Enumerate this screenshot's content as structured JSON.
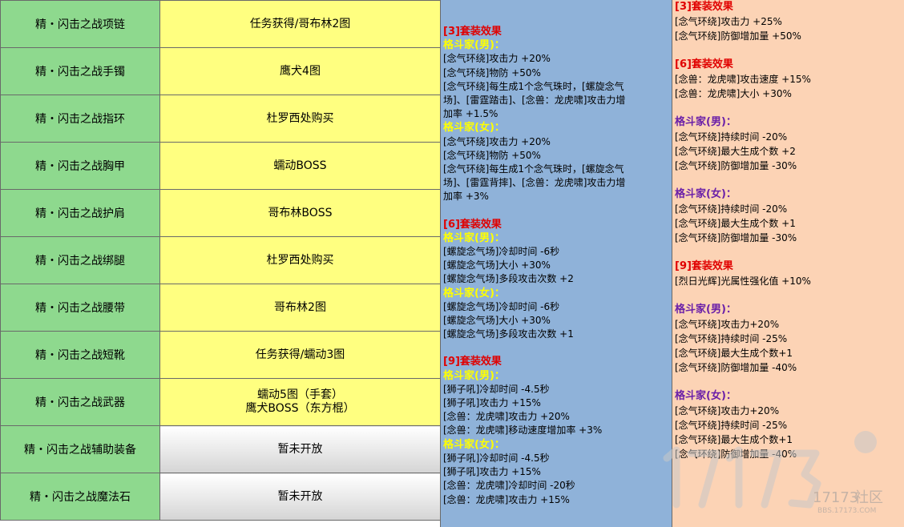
{
  "items": [
    {
      "name": "精・闪击之战项链",
      "source": [
        "任务获得/哥布林2图"
      ],
      "pending": false
    },
    {
      "name": "精・闪击之战手镯",
      "source": [
        "鹰犬4图"
      ],
      "pending": false
    },
    {
      "name": "精・闪击之战指环",
      "source": [
        "杜罗西处购买"
      ],
      "pending": false
    },
    {
      "name": "精・闪击之战胸甲",
      "source": [
        "蠕动BOSS"
      ],
      "pending": false
    },
    {
      "name": "精・闪击之战护肩",
      "source": [
        "哥布林BOSS"
      ],
      "pending": false
    },
    {
      "name": "精・闪击之战绑腿",
      "source": [
        "杜罗西处购买"
      ],
      "pending": false
    },
    {
      "name": "精・闪击之战腰带",
      "source": [
        "哥布林2图"
      ],
      "pending": false
    },
    {
      "name": "精・闪击之战短靴",
      "source": [
        "任务获得/蠕动3图"
      ],
      "pending": false
    },
    {
      "name": "精・闪击之战武器",
      "source": [
        "蠕动5图（手套）",
        "鹰犬BOSS（东方棍）"
      ],
      "pending": false
    },
    {
      "name": "精・闪击之战辅助装备",
      "source": [
        "暂未开放"
      ],
      "pending": true
    },
    {
      "name": "精・闪击之战魔法石",
      "source": [
        "暂未开放"
      ],
      "pending": true
    }
  ],
  "col3": [
    {
      "t": "red",
      "text": "[3]套装效果"
    },
    {
      "t": "yel",
      "text": "格斗家(男)："
    },
    {
      "t": "n",
      "text": "[念气环绕]攻击力 +20%"
    },
    {
      "t": "n",
      "text": "[念气环绕]物防 +50%"
    },
    {
      "t": "n",
      "text": "[念气环绕]每生成1个念气珠时，[螺旋念气"
    },
    {
      "t": "n",
      "text": "场]、[雷霆踏击]、[念兽：龙虎啸]攻击力增"
    },
    {
      "t": "n",
      "text": "加率 +1.5%"
    },
    {
      "t": "yel",
      "text": "格斗家(女)："
    },
    {
      "t": "n",
      "text": "[念气环绕]攻击力 +20%"
    },
    {
      "t": "n",
      "text": "[念气环绕]物防 +50%"
    },
    {
      "t": "n",
      "text": "[念气环绕]每生成1个念气珠时，[螺旋念气"
    },
    {
      "t": "n",
      "text": "场]、[雷霆背摔]、[念兽：龙虎啸]攻击力增"
    },
    {
      "t": "n",
      "text": "加率 +3%"
    },
    {
      "t": "gap",
      "text": ""
    },
    {
      "t": "red",
      "text": "[6]套装效果"
    },
    {
      "t": "yel",
      "text": "格斗家(男)："
    },
    {
      "t": "n",
      "text": "[螺旋念气场]冷却时间 -6秒"
    },
    {
      "t": "n",
      "text": "[螺旋念气场]大小 +30%"
    },
    {
      "t": "n",
      "text": "[螺旋念气场]多段攻击次数 +2"
    },
    {
      "t": "yel",
      "text": "格斗家(女)："
    },
    {
      "t": "n",
      "text": "[螺旋念气场]冷却时间 -6秒"
    },
    {
      "t": "n",
      "text": "[螺旋念气场]大小 +30%"
    },
    {
      "t": "n",
      "text": "[螺旋念气场]多段攻击次数 +1"
    },
    {
      "t": "gap",
      "text": ""
    },
    {
      "t": "red",
      "text": "[9]套装效果"
    },
    {
      "t": "yel",
      "text": "格斗家(男)："
    },
    {
      "t": "n",
      "text": "[狮子吼]冷却时间 -4.5秒"
    },
    {
      "t": "n",
      "text": "[狮子吼]攻击力 +15%"
    },
    {
      "t": "n",
      "text": "[念兽：龙虎啸]攻击力 +20%"
    },
    {
      "t": "n",
      "text": "[念兽：龙虎啸]移动速度增加率 +3%"
    },
    {
      "t": "yel",
      "text": "格斗家(女)："
    },
    {
      "t": "n",
      "text": "[狮子吼]冷却时间 -4.5秒"
    },
    {
      "t": "n",
      "text": "[狮子吼]攻击力 +15%"
    },
    {
      "t": "n",
      "text": "[念兽：龙虎啸]冷却时间 -20秒"
    },
    {
      "t": "n",
      "text": "[念兽：龙虎啸]攻击力 +15%"
    }
  ],
  "col4": [
    {
      "t": "red",
      "text": "[3]套装效果"
    },
    {
      "t": "n",
      "text": "[念气环绕]攻击力 +25%"
    },
    {
      "t": "n",
      "text": "[念气环绕]防御增加量 +50%"
    },
    {
      "t": "gap",
      "text": ""
    },
    {
      "t": "red",
      "text": "[6]套装效果"
    },
    {
      "t": "n",
      "text": "[念兽：龙虎啸]攻击速度 +15%"
    },
    {
      "t": "n",
      "text": "[念兽：龙虎啸]大小 +30%"
    },
    {
      "t": "gap",
      "text": ""
    },
    {
      "t": "pur",
      "text": "格斗家(男)："
    },
    {
      "t": "n",
      "text": "[念气环绕]持续时间 -20%"
    },
    {
      "t": "n",
      "text": "[念气环绕]最大生成个数 +2"
    },
    {
      "t": "n",
      "text": "[念气环绕]防御增加量 -30%"
    },
    {
      "t": "gap",
      "text": ""
    },
    {
      "t": "pur",
      "text": "格斗家(女)："
    },
    {
      "t": "n",
      "text": "[念气环绕]持续时间 -20%"
    },
    {
      "t": "n",
      "text": "[念气环绕]最大生成个数 +1"
    },
    {
      "t": "n",
      "text": "[念气环绕]防御增加量 -30%"
    },
    {
      "t": "gap",
      "text": ""
    },
    {
      "t": "red",
      "text": "[9]套装效果"
    },
    {
      "t": "n",
      "text": "[烈日光辉]光属性强化值 +10%"
    },
    {
      "t": "gap",
      "text": ""
    },
    {
      "t": "pur",
      "text": "格斗家(男)："
    },
    {
      "t": "n",
      "text": "[念气环绕]攻击力+20%"
    },
    {
      "t": "n",
      "text": "[念气环绕]持续时间 -25%"
    },
    {
      "t": "n",
      "text": "[念气环绕]最大生成个数+1"
    },
    {
      "t": "n",
      "text": "[念气环绕]防御增加量 -40%"
    },
    {
      "t": "gap",
      "text": ""
    },
    {
      "t": "pur",
      "text": "格斗家(女)："
    },
    {
      "t": "n",
      "text": "[念气环绕]攻击力+20%"
    },
    {
      "t": "n",
      "text": "[念气环绕]持续时间 -25%"
    },
    {
      "t": "n",
      "text": "[念气环绕]最大生成个数+1"
    },
    {
      "t": "n",
      "text": "[念气环绕]防御增加量 -40%"
    }
  ],
  "watermark": {
    "logo": "17173",
    "label": "社区",
    "url": "BBS.17173.COM"
  },
  "colors": {
    "name_bg": "#8ed98e",
    "source_bg": "#ffff80",
    "col3_bg": "#8fb2d9",
    "col4_bg": "#fcd3b5",
    "red": "#e00000",
    "yellow": "#ffff00",
    "purple": "#6a1fa8"
  }
}
